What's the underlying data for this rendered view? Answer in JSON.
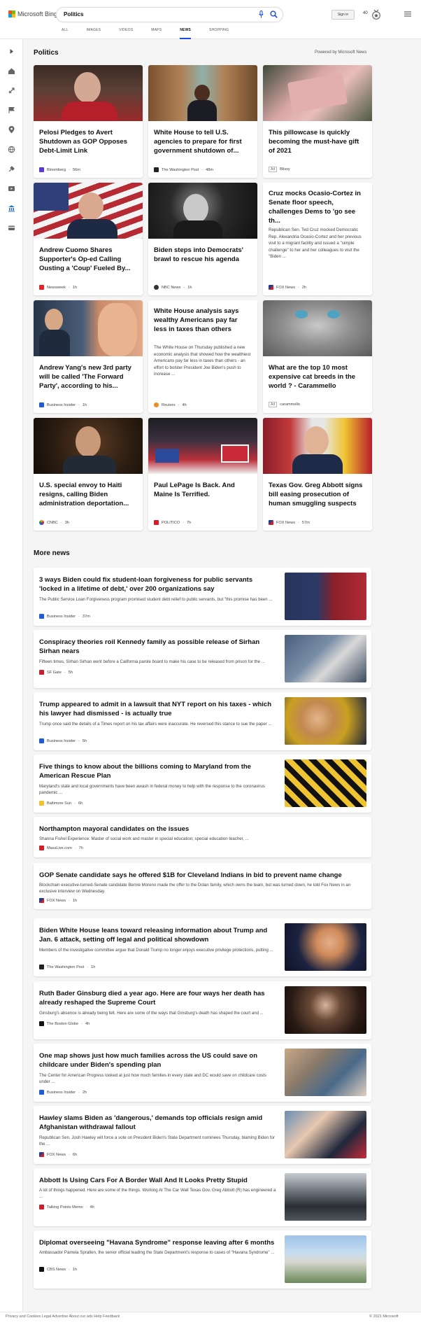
{
  "header": {
    "brand": "Microsoft Bing",
    "query": "Politics",
    "signin": "Sign in",
    "points": "40",
    "tabs": [
      {
        "label": "ALL"
      },
      {
        "label": "IMAGES"
      },
      {
        "label": "VIDEOS"
      },
      {
        "label": "MAPS"
      },
      {
        "label": "NEWS"
      },
      {
        "label": "SHOPPING"
      }
    ],
    "active_tab": "NEWS"
  },
  "section": {
    "title": "Politics",
    "powered": "Powered by Microsoft News"
  },
  "cards": [
    {
      "title": "Pelosi Pledges to Avert Shutdown as GOP Opposes Debt-Limit Link",
      "source": "Bloomberg",
      "time": "56m"
    },
    {
      "title": "White House to tell U.S. agencies to prepare for first government shutdown of...",
      "source": "The Washington Post",
      "time": "48m"
    },
    {
      "title": "This pillowcase is quickly becoming the must-have gift of 2021",
      "ad": "Ad",
      "source": "Blissy"
    },
    {
      "title": "Andrew Cuomo Shares Supporter's Op-ed Calling Ousting a 'Coup' Fueled By...",
      "source": "Newsweek",
      "time": "1h"
    },
    {
      "title": "Biden steps into Democrats' brawl to rescue his agenda",
      "source": "NBC News",
      "time": "1h"
    },
    {
      "title": "Cruz mocks Ocasio-Cortez in Senate floor speech, challenges Dems to 'go see th...",
      "snippet": "Republican Sen. Ted Cruz mocked Democratic Rep. Alexandria Ocasio-Cortez and her previous visit to a migrant facility and issued a \"simple challenge\" to her and her colleagues to visit the \"Biden ...",
      "source": "FOX News",
      "time": "2h"
    },
    {
      "title": "Andrew Yang's new 3rd party will be called 'The Forward Party', according to his...",
      "source": "Business Insider",
      "time": "1h"
    },
    {
      "title": "White House analysis says wealthy Americans pay far less in taxes than others",
      "snippet": "The White House on Thursday published a new economic analysis that showed how the wealthiest Americans pay far less in taxes than others - an effort to bolster President Joe Biden's push to increase ...",
      "source": "Reuters",
      "time": "4h"
    },
    {
      "title": "What are the top 10 most expensive cat breeds in the world ? - Carammello",
      "ad": "Ad",
      "source": "carammello"
    },
    {
      "title": "U.S. special envoy to Haiti resigns, calling Biden administration deportation...",
      "source": "CNBC",
      "time": "3h"
    },
    {
      "title": "Paul LePage Is Back. And Maine Is Terrified.",
      "source": "POLITICO",
      "time": "7h"
    },
    {
      "title": "Texas Gov. Greg Abbott signs bill easing prosecution of human smuggling suspects",
      "source": "FOX News",
      "time": "57m"
    }
  ],
  "more": {
    "title": "More news"
  },
  "news": [
    {
      "title": "3 ways Biden could fix student-loan forgiveness for public servants 'locked in a lifetime of debt,' over 200 organizations say",
      "snippet": "The Public Service Loan Forgiveness program promised student debt relief to public servants, but \"this promise has been ...",
      "source": "Business Insider",
      "time": "37m"
    },
    {
      "title": "Conspiracy theories roil Kennedy family as possible release of Sirhan Sirhan nears",
      "snippet": "Fifteen times, Sirhan Sirhan went before a California parole board to make his case to be released from prison for the ...",
      "source": "SF Gate",
      "time": "5h"
    },
    {
      "title": "Trump appeared to admit in a lawsuit that NYT report on his taxes - which his lawyer had dismissed - is actually true",
      "snippet": "Trump once said the details of a Times report on his tax affairs were inaccurate. He reversed this stance to sue the paper ...",
      "source": "Business Insider",
      "time": "5h"
    },
    {
      "title": "Five things to know about the billions coming to Maryland from the American Rescue Plan",
      "snippet": "Maryland's state and local governments have been awash in federal money to help with the response to the coronavirus pandemic ...",
      "source": "Baltimore Sun",
      "time": "6h"
    },
    {
      "title": "Northampton mayoral candidates on the issues",
      "snippet": "Shanna Fishel Experience: Master of social work and master in special education; special education teacher, ...",
      "source": "MassLive.com",
      "time": "7h"
    },
    {
      "title": "GOP Senate candidate says he offered $1B for Cleveland Indians in bid to prevent name change",
      "snippet": "Blockchain executive-turned-Senate candidate Bernie Moreno made the offer to the Dolan family, which owns the team, but was turned down, he told Fox News in an exclusive interview on Wednesday.",
      "source": "FOX News",
      "time": "1h"
    },
    {
      "title": "Biden White House leans toward releasing information about Trump and Jan. 6 attack, setting off legal and political showdown",
      "snippet": "Members of the investigative committee argue that Donald Trump no longer enjoys executive privilege protections, putting ...",
      "source": "The Washington Post",
      "time": "1h"
    },
    {
      "title": "Ruth Bader Ginsburg died a year ago. Here are four ways her death has already reshaped the Supreme Court",
      "snippet": "Ginsburg's absence is already being felt. Here are some of the ways that Ginsburg's death has shaped the court and ...",
      "source": "The Boston Globe",
      "time": "4h"
    },
    {
      "title": "One map shows just how much families across the US could save on childcare under Biden's spending plan",
      "snippet": "The Center for American Progress looked at just how much families in every state and DC would save on childcare costs under ...",
      "source": "Business Insider",
      "time": "2h"
    },
    {
      "title": "Hawley slams Biden as 'dangerous,' demands top officials resign amid Afghanistan withdrawal fallout",
      "snippet": "Republican Sen. Josh Hawley will force a vote on President Biden's State Department nominees Thursday, blaming Biden for the ...",
      "source": "FOX News",
      "time": "6h"
    },
    {
      "title": "Abbott Is Using Cars For A Border Wall And It Looks Pretty Stupid",
      "snippet": "A lot of things happened. Here are some of the things. Working At The Car Wall Texas Gov. Greg Abbott (R) has engineered a ...",
      "source": "Talking Points Memo",
      "time": "4h"
    },
    {
      "title": "Diplomat overseeing \"Havana Syndrome\" response leaving after 6 months",
      "snippet": "Ambassador Pamela Spratlen, the senior official leading the State Department's response to cases of \"Havana Syndrome\" ...",
      "source": "CBS News",
      "time": "1h"
    }
  ],
  "footer": {
    "left": "Privacy and Cookies  Legal  Advertise  About our ads  Help  Feedback",
    "right": "© 2021 Microsoft"
  },
  "colors": {
    "accent": "#174ae4",
    "ms_red": "#f25022",
    "ms_green": "#7fba00",
    "ms_blue": "#00a4ef",
    "ms_yellow": "#ffb900"
  }
}
